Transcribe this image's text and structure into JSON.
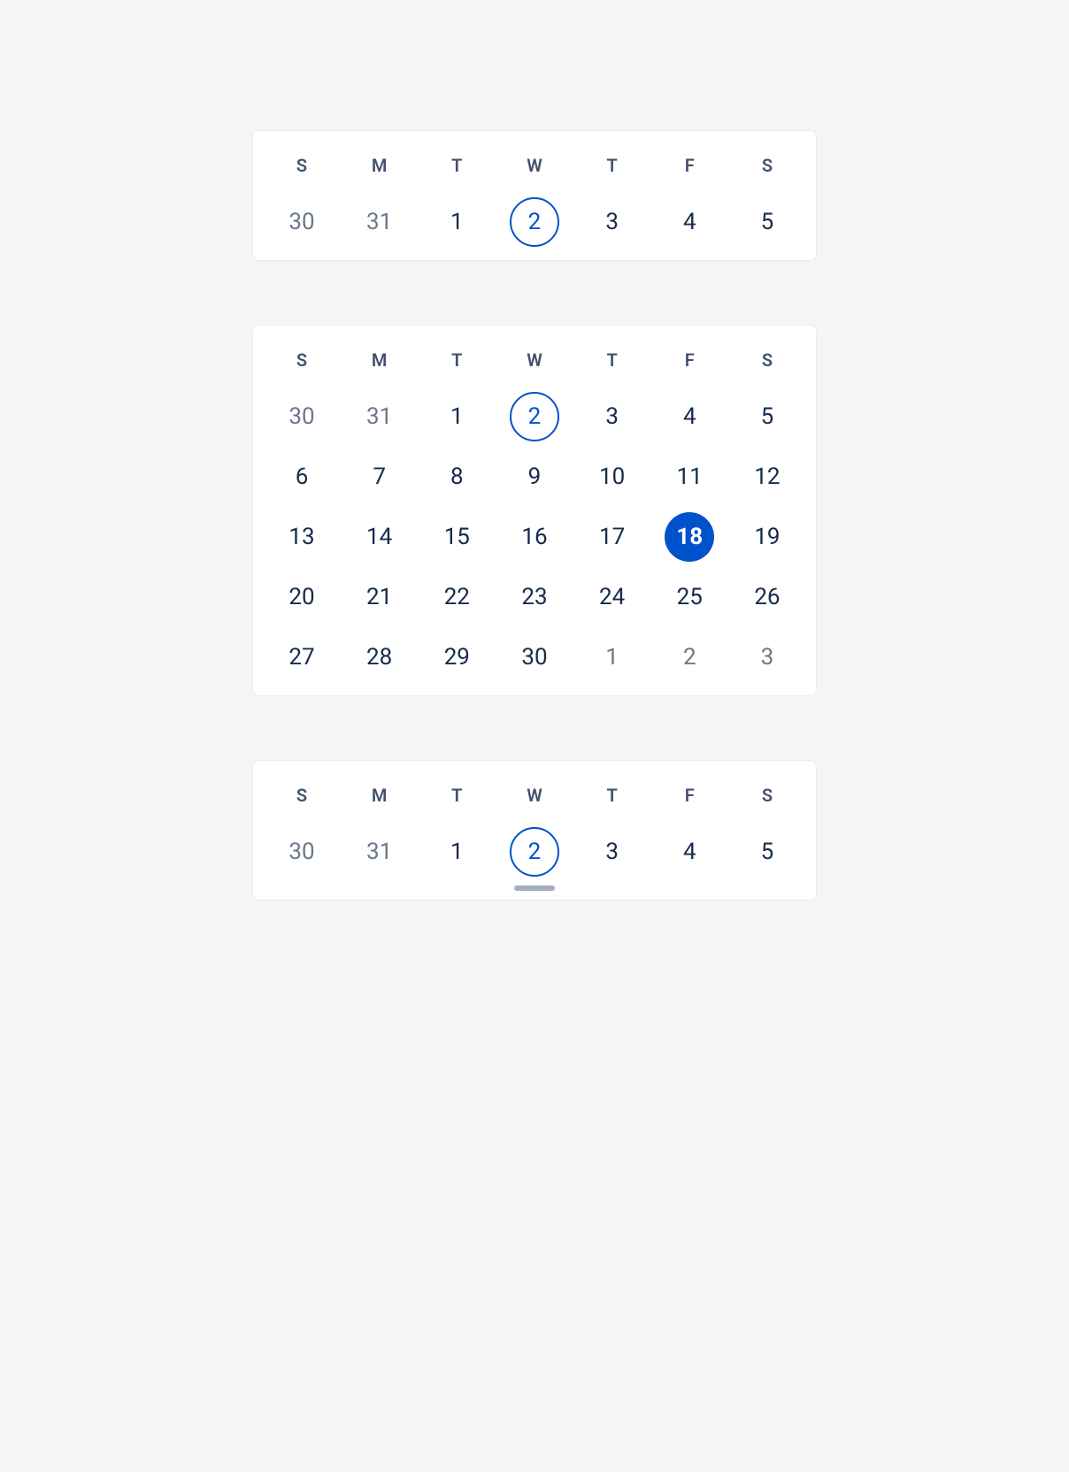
{
  "week_headers": [
    "S",
    "M",
    "T",
    "W",
    "T",
    "F",
    "S"
  ],
  "panels": [
    {
      "id": "cal-collapsed",
      "rows": [
        [
          {
            "n": "30",
            "other": true
          },
          {
            "n": "31",
            "other": true
          },
          {
            "n": "1"
          },
          {
            "n": "2",
            "today": true
          },
          {
            "n": "3"
          },
          {
            "n": "4"
          },
          {
            "n": "5"
          }
        ]
      ],
      "handle": false
    },
    {
      "id": "cal-full",
      "rows": [
        [
          {
            "n": "30",
            "other": true
          },
          {
            "n": "31",
            "other": true
          },
          {
            "n": "1"
          },
          {
            "n": "2",
            "today": true
          },
          {
            "n": "3"
          },
          {
            "n": "4"
          },
          {
            "n": "5"
          }
        ],
        [
          {
            "n": "6"
          },
          {
            "n": "7"
          },
          {
            "n": "8"
          },
          {
            "n": "9"
          },
          {
            "n": "10"
          },
          {
            "n": "11"
          },
          {
            "n": "12"
          }
        ],
        [
          {
            "n": "13"
          },
          {
            "n": "14"
          },
          {
            "n": "15"
          },
          {
            "n": "16"
          },
          {
            "n": "17"
          },
          {
            "n": "18",
            "selected": true
          },
          {
            "n": "19"
          }
        ],
        [
          {
            "n": "20"
          },
          {
            "n": "21"
          },
          {
            "n": "22"
          },
          {
            "n": "23"
          },
          {
            "n": "24"
          },
          {
            "n": "25"
          },
          {
            "n": "26"
          }
        ],
        [
          {
            "n": "27"
          },
          {
            "n": "28"
          },
          {
            "n": "29"
          },
          {
            "n": "30"
          },
          {
            "n": "1",
            "other": true
          },
          {
            "n": "2",
            "other": true
          },
          {
            "n": "3",
            "other": true
          }
        ]
      ],
      "handle": false
    },
    {
      "id": "cal-collapsed-handle",
      "rows": [
        [
          {
            "n": "30",
            "other": true
          },
          {
            "n": "31",
            "other": true
          },
          {
            "n": "1"
          },
          {
            "n": "2",
            "today": true
          },
          {
            "n": "3"
          },
          {
            "n": "4"
          },
          {
            "n": "5"
          }
        ]
      ],
      "handle": true
    }
  ]
}
